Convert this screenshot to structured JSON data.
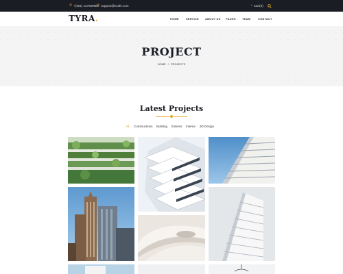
{
  "topbar": {
    "phone": "+(501) 127859881",
    "email": "support@exafe.com",
    "cart": "Cart(0)"
  },
  "header": {
    "logo": "TYRA",
    "logo_dot": ".",
    "nav": [
      "HOME",
      "SERVICE",
      "ABOUT US",
      "PAGES",
      "TEAM",
      "CONTACT"
    ]
  },
  "hero": {
    "title": "PROJECT",
    "breadcrumb_home": "HOME",
    "breadcrumb_sep": "/",
    "breadcrumb_current": "PROJECTS"
  },
  "section": {
    "title": "Latest Projects",
    "filters": [
      "All",
      "Constructions",
      "Building",
      "Exterior",
      "Interior",
      "3D Design"
    ],
    "active_filter": "All"
  },
  "colors": {
    "accent": "#e0a52a",
    "topbar_bg": "#1b1d24"
  },
  "icons": [
    "phone-icon",
    "mail-icon",
    "cart-icon",
    "search-icon"
  ]
}
